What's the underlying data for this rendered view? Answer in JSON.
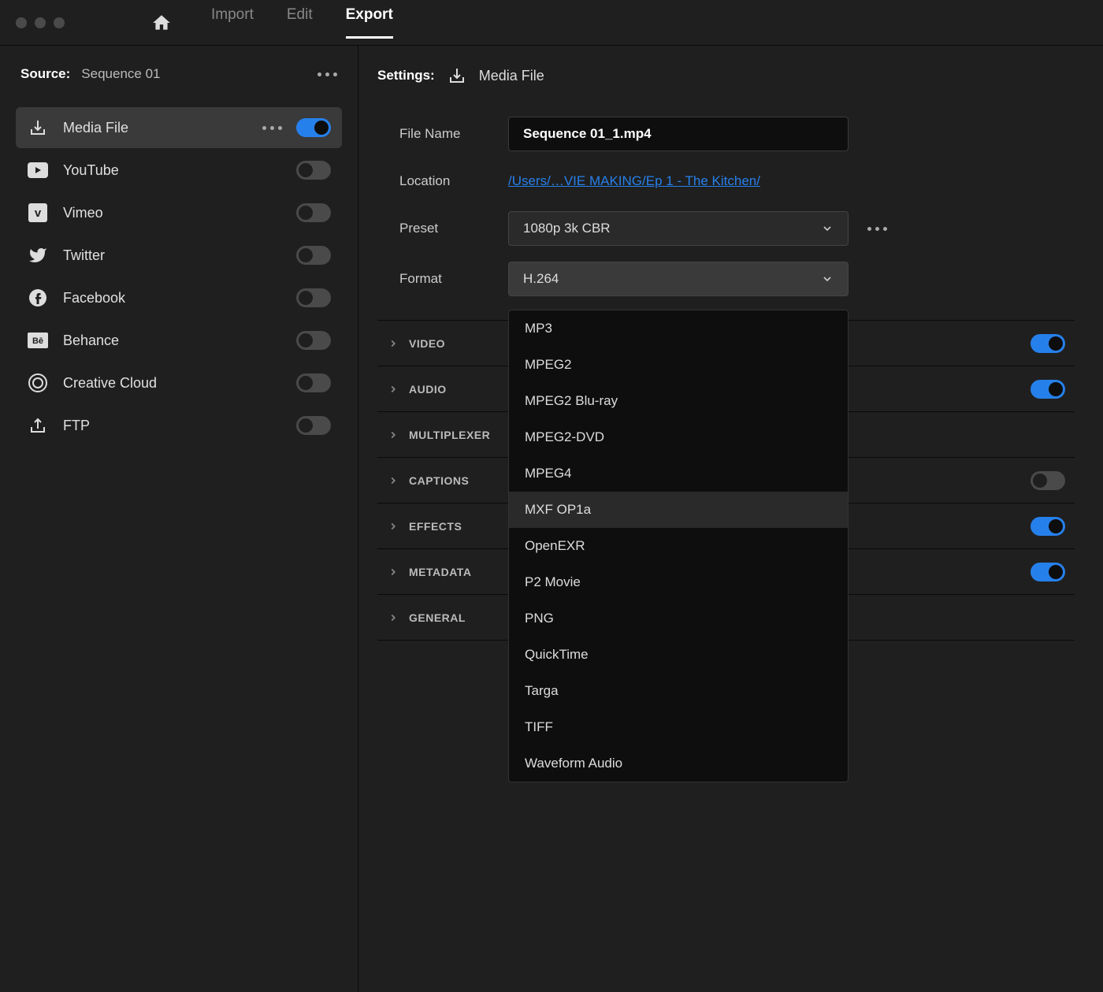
{
  "tabs": {
    "import": "Import",
    "edit": "Edit",
    "export": "Export",
    "active": "export"
  },
  "source": {
    "label": "Source:",
    "name": "Sequence 01"
  },
  "destinations": [
    {
      "id": "media-file",
      "label": "Media File",
      "icon": "download",
      "on": true,
      "selected": true
    },
    {
      "id": "youtube",
      "label": "YouTube",
      "icon": "youtube",
      "on": false
    },
    {
      "id": "vimeo",
      "label": "Vimeo",
      "icon": "vimeo",
      "on": false
    },
    {
      "id": "twitter",
      "label": "Twitter",
      "icon": "twitter",
      "on": false
    },
    {
      "id": "facebook",
      "label": "Facebook",
      "icon": "facebook",
      "on": false
    },
    {
      "id": "behance",
      "label": "Behance",
      "icon": "behance",
      "on": false
    },
    {
      "id": "creative-cloud",
      "label": "Creative Cloud",
      "icon": "cc",
      "on": false
    },
    {
      "id": "ftp",
      "label": "FTP",
      "icon": "upload",
      "on": false
    }
  ],
  "settings": {
    "label": "Settings:",
    "name": "Media File",
    "fileName": {
      "label": "File Name",
      "value": "Sequence 01_1.mp4"
    },
    "location": {
      "label": "Location",
      "value": "/Users/…VIE MAKING/Ep 1 - The Kitchen/"
    },
    "preset": {
      "label": "Preset",
      "value": "1080p 3k CBR"
    },
    "format": {
      "label": "Format",
      "value": "H.264"
    }
  },
  "formatOptions": [
    "MP3",
    "MPEG2",
    "MPEG2 Blu-ray",
    "MPEG2-DVD",
    "MPEG4",
    "MXF OP1a",
    "OpenEXR",
    "P2 Movie",
    "PNG",
    "QuickTime",
    "Targa",
    "TIFF",
    "Waveform Audio"
  ],
  "formatHighlighted": "MXF OP1a",
  "sections": [
    {
      "id": "video",
      "label": "VIDEO",
      "on": true,
      "hasToggle": true
    },
    {
      "id": "audio",
      "label": "AUDIO",
      "on": true,
      "hasToggle": true
    },
    {
      "id": "multiplexer",
      "label": "MULTIPLEXER",
      "hasToggle": false
    },
    {
      "id": "captions",
      "label": "CAPTIONS",
      "on": false,
      "hasToggle": true
    },
    {
      "id": "effects",
      "label": "EFFECTS",
      "on": true,
      "hasToggle": true
    },
    {
      "id": "metadata",
      "label": "METADATA",
      "on": true,
      "hasToggle": true
    },
    {
      "id": "general",
      "label": "GENERAL",
      "hasToggle": false
    }
  ]
}
